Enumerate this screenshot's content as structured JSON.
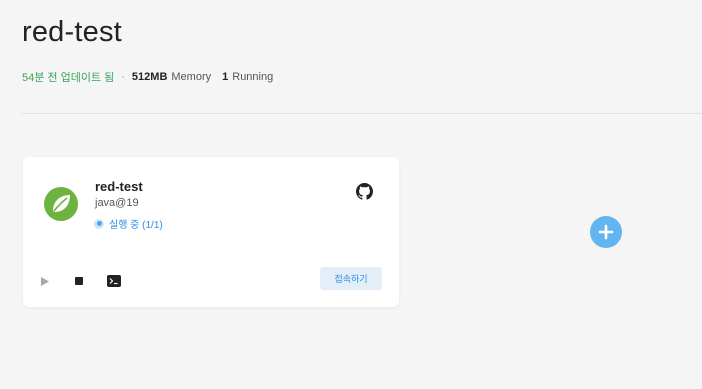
{
  "header": {
    "title": "red-test",
    "updated": "54분 전 업데이트 됨",
    "separator": "·",
    "memory_value": "512MB",
    "memory_label": "Memory",
    "running_value": "1",
    "running_label": "Running"
  },
  "card": {
    "name": "red-test",
    "runtime": "java@19",
    "status": "실행 중 (1/1)",
    "connect_label": "접속하기",
    "logo_icon": "spring-leaf-icon",
    "repo_icon": "github-icon",
    "controls": [
      "play-icon",
      "stop-icon",
      "terminal-icon"
    ]
  },
  "colors": {
    "accent": "#2a8ee8",
    "updated": "#3aa65a",
    "spring": "#6db33f",
    "add_button": "#63b5ef"
  }
}
